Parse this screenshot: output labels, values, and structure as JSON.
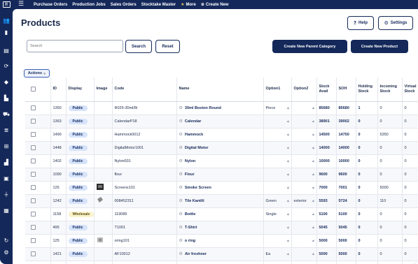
{
  "topnav": {
    "items": [
      {
        "label": "Purchase Orders",
        "icon": ""
      },
      {
        "label": "Production Jobs",
        "icon": ""
      },
      {
        "label": "Sales Orders",
        "icon": ""
      },
      {
        "label": "Stocktake Master",
        "icon": ""
      },
      {
        "label": "More",
        "icon": "star-icon"
      },
      {
        "label": "Create New",
        "icon": "plus-icon"
      }
    ]
  },
  "sidebar": {
    "icons": [
      "users-icon",
      "book-icon",
      "clipboard-icon",
      "cycle-icon",
      "tag-icon",
      "factory-icon",
      "cart-icon",
      "stack-icon",
      "sitemap-icon",
      "chart-icon",
      "briefcase-icon",
      "plug-icon",
      "store-icon",
      "refresh-icon",
      "gear-icon"
    ]
  },
  "page": {
    "title": "Products",
    "help_label": "Help",
    "settings_label": "Settings"
  },
  "search": {
    "placeholder": "Search",
    "value": "",
    "search_label": "Search",
    "reset_label": "Reset"
  },
  "buttons": {
    "create_parent_category": "Create New Parent Category",
    "create_product": "Create New Product",
    "actions": "Actions"
  },
  "table": {
    "columns": [
      "",
      "ID",
      "Display",
      "Image",
      "Code",
      "Name",
      "Option1",
      "Option2",
      "Stock Avail",
      "SOH",
      "Holding Stock",
      "Incoming Stock",
      "Virtual Stock"
    ],
    "rows": [
      {
        "id": "1350",
        "display": "Public",
        "image": "",
        "code": "R025-30ml/8i",
        "name": "30ml Boston Round",
        "option1": "Piece",
        "option2": "",
        "stock_avail": "85680",
        "soh": "85680",
        "holding": "1",
        "incoming": "0",
        "virtual": "0"
      },
      {
        "id": "1363",
        "display": "Public",
        "image": "",
        "code": "CalendarP18",
        "name": "Calendar",
        "option1": "",
        "option2": "",
        "stock_avail": "38901",
        "soh": "39002",
        "holding": "0",
        "incoming": "0",
        "virtual": "0"
      },
      {
        "id": "1490",
        "display": "Public",
        "image": "",
        "code": "Hammock0012",
        "name": "Hammock",
        "option1": "",
        "option2": "",
        "stock_avail": "14500",
        "soh": "14750",
        "holding": "0",
        "incoming": "5350",
        "virtual": "0"
      },
      {
        "id": "1448",
        "display": "Public",
        "image": "",
        "code": "DigitalMotor1001",
        "name": "Digital Motor",
        "option1": "",
        "option2": "",
        "stock_avail": "14000",
        "soh": "14000",
        "holding": "0",
        "incoming": "0",
        "virtual": "0"
      },
      {
        "id": "1402",
        "display": "Public",
        "image": "",
        "code": "Nylon001",
        "name": "Nylon",
        "option1": "",
        "option2": "",
        "stock_avail": "10000",
        "soh": "10000",
        "holding": "0",
        "incoming": "0",
        "virtual": "0"
      },
      {
        "id": "1090",
        "display": "Public",
        "image": "",
        "code": "flour",
        "name": "Flour",
        "option1": "",
        "option2": "",
        "stock_avail": "9600",
        "soh": "9600",
        "holding": "0",
        "incoming": "0",
        "virtual": "0"
      },
      {
        "id": "126",
        "display": "Public",
        "image": "screen-thumb",
        "code": "Screens101",
        "name": "Smoke Screen",
        "option1": "",
        "option2": "",
        "stock_avail": "7000",
        "soh": "7001",
        "holding": "0",
        "incoming": "5000",
        "virtual": "0"
      },
      {
        "id": "1242",
        "display": "Public",
        "image": "tile-thumb",
        "code": "008452311",
        "name": "Tile Kantili",
        "option1": "Green",
        "option2": "exterior",
        "stock_avail": "5593",
        "soh": "5724",
        "holding": "0",
        "incoming": "110",
        "virtual": "0"
      },
      {
        "id": "1158",
        "display": "Wholesale",
        "image": "",
        "code": "119085",
        "name": "Bottle",
        "option1": "Single",
        "option2": "",
        "stock_avail": "5100",
        "soh": "5100",
        "holding": "0",
        "incoming": "0",
        "virtual": "0"
      },
      {
        "id": "495",
        "display": "Public",
        "image": "",
        "code": "T1001",
        "name": "T-Shirt",
        "option1": "",
        "option2": "",
        "stock_avail": "5045",
        "soh": "5045",
        "holding": "0",
        "incoming": "0",
        "virtual": "0"
      },
      {
        "id": "125",
        "display": "Public",
        "image": "ring-thumb",
        "code": "oring101",
        "name": "o ring",
        "option1": "",
        "option2": "",
        "stock_avail": "5000",
        "soh": "5000",
        "holding": "0",
        "incoming": "0",
        "virtual": "0"
      },
      {
        "id": "1421",
        "display": "Public",
        "image": "",
        "code": "AF10012",
        "name": "Air freshner",
        "option1": "Ea",
        "option2": "",
        "stock_avail": "5000",
        "soh": "5000",
        "holding": "0",
        "incoming": "0",
        "virtual": "0"
      },
      {
        "id": "1514",
        "display": "Public",
        "image": "",
        "code": "Par0123",
        "name": "Paracetemol",
        "option1": "",
        "option2": "",
        "stock_avail": "5000",
        "soh": "5000",
        "holding": "1000",
        "incoming": "0",
        "virtual": "0"
      }
    ]
  },
  "colors": {
    "navy": "#14285a",
    "public_badge": "#d6e3fb",
    "wholesale_badge": "#fbf3cc"
  }
}
